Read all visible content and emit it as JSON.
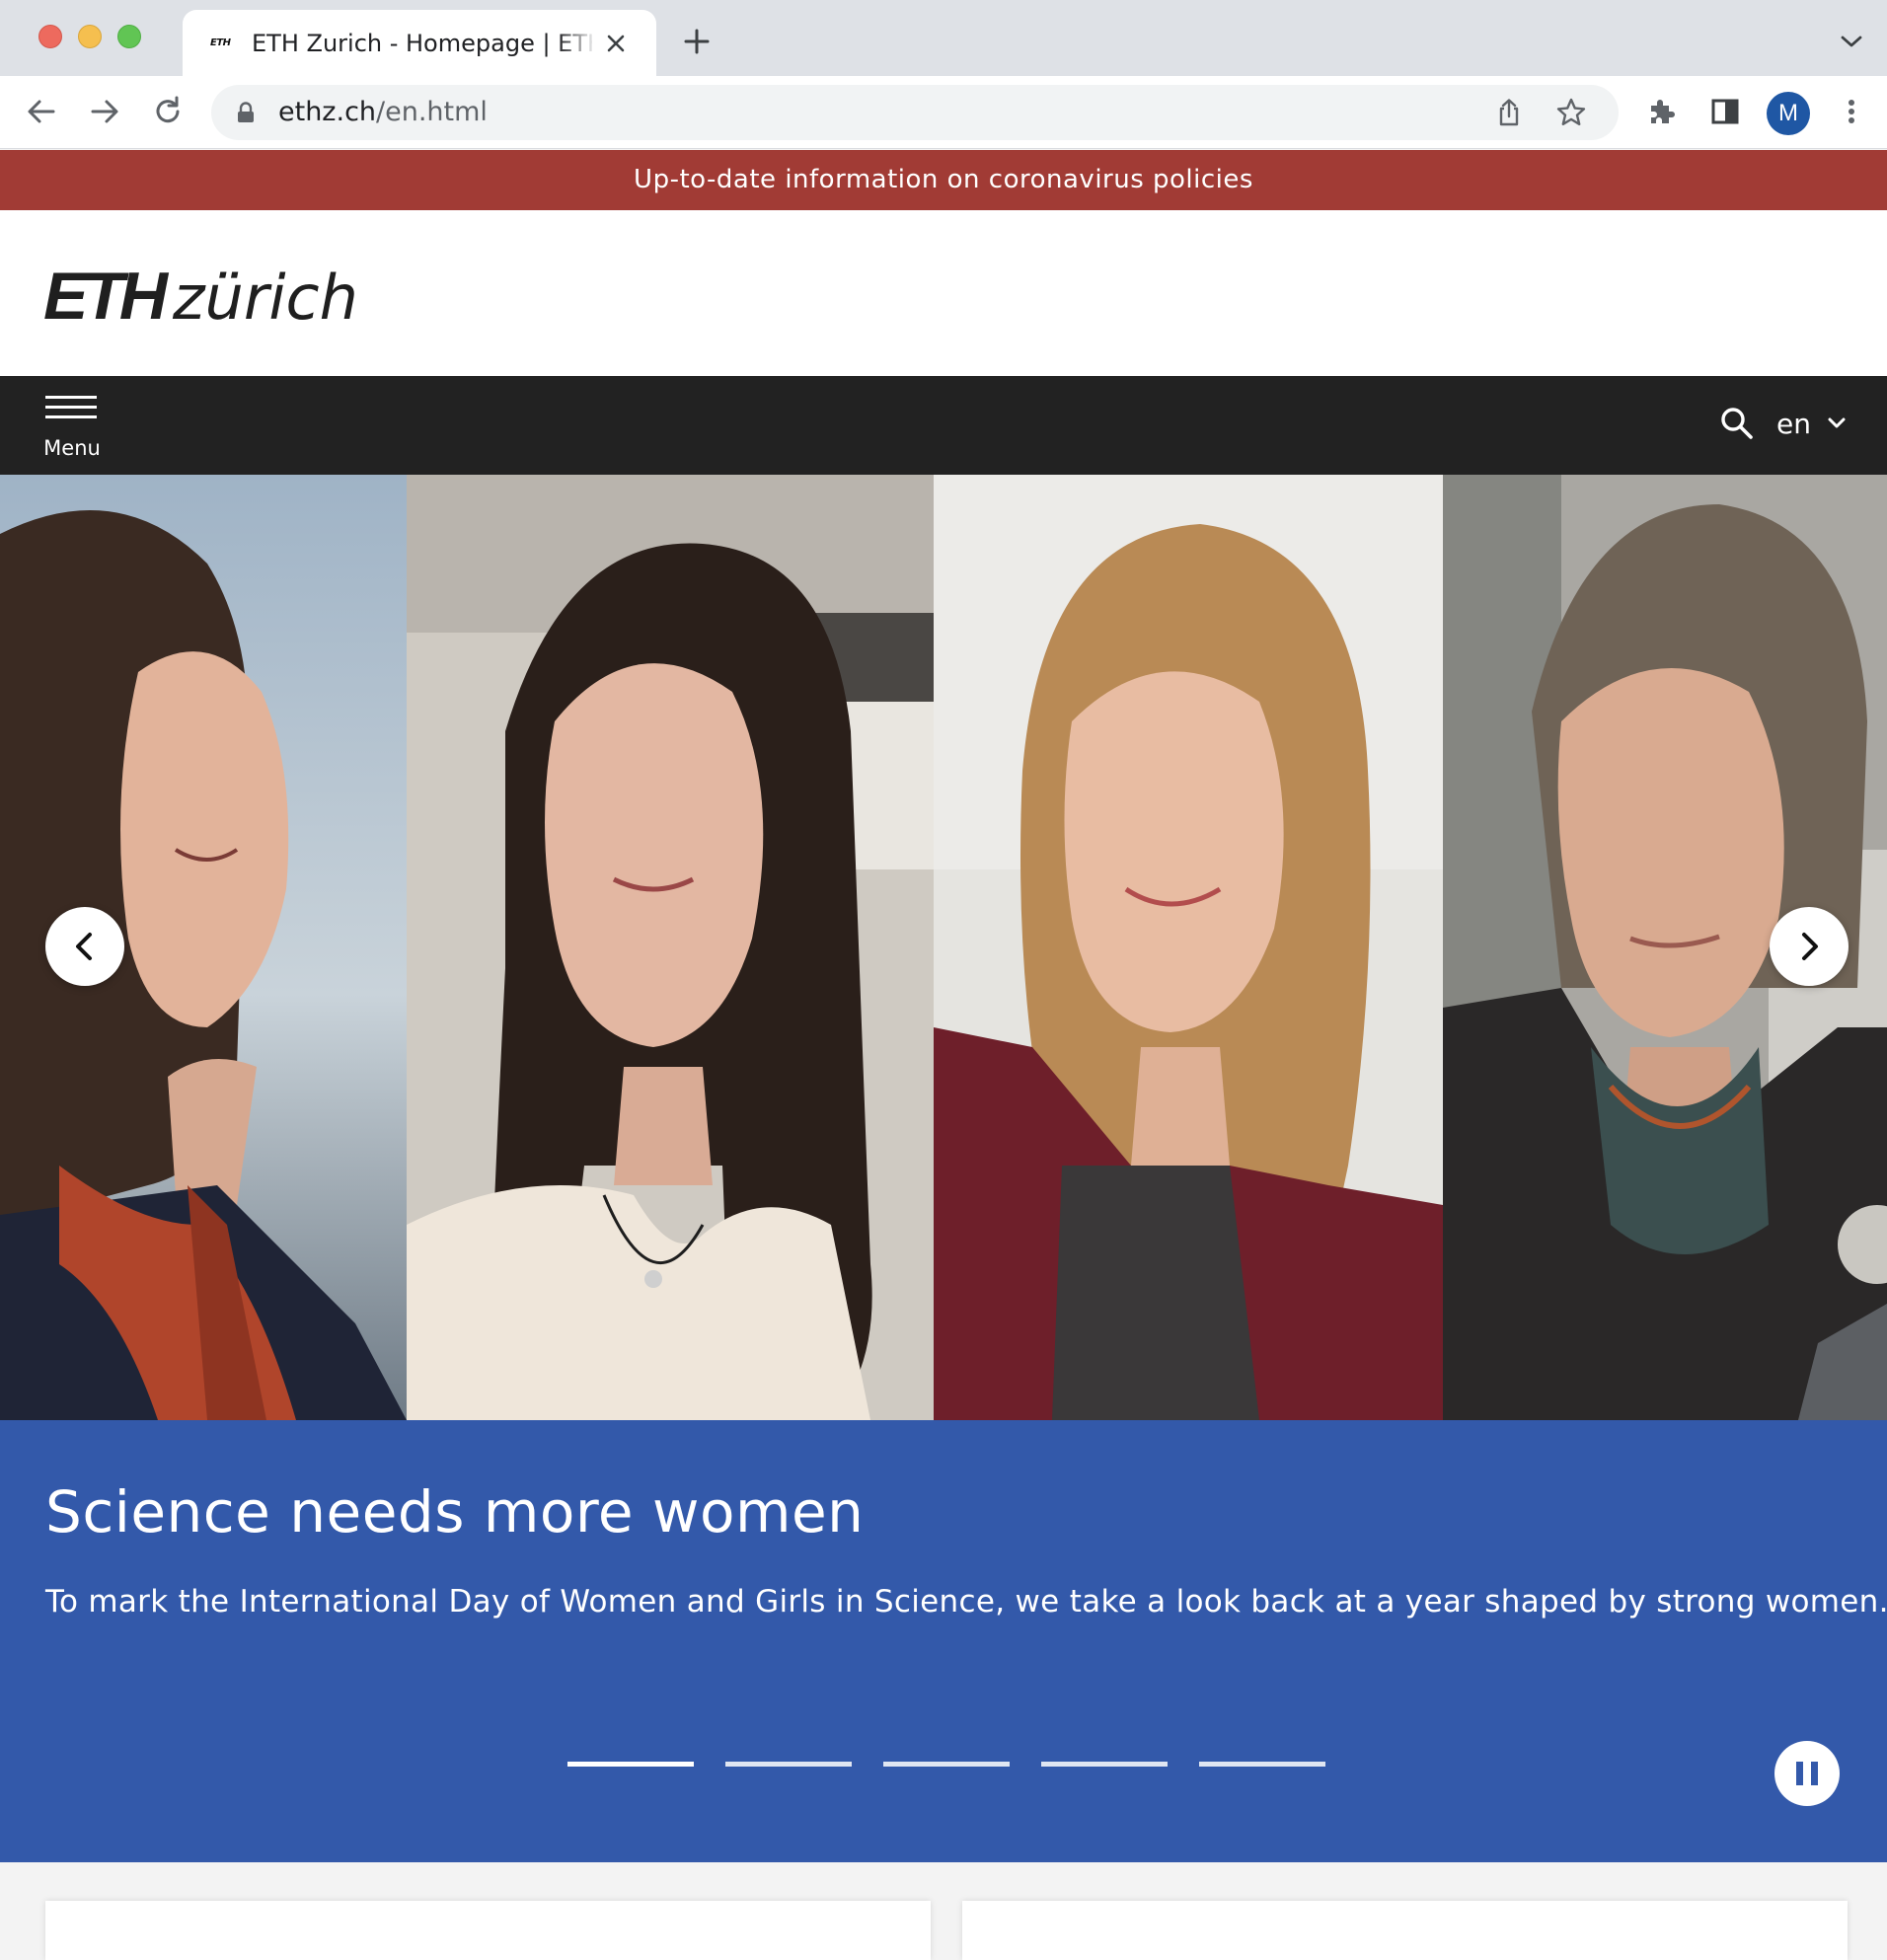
{
  "browser": {
    "tab_title": "ETH Zurich - Homepage | ETH Zurich",
    "tab_favicon_text": "ETH",
    "url_domain": "ethz.ch",
    "url_path": "/en.html",
    "profile_initial": "M"
  },
  "banner": {
    "text": "Up-to-date information on coronavirus policies",
    "color": "#a13b35"
  },
  "header": {
    "logo_eth": "ETH",
    "logo_zurich": "zürich"
  },
  "nav": {
    "menu_label": "Menu",
    "language": "en"
  },
  "hero": {
    "title": "Science needs more women",
    "subtitle": "To mark the International Day of Women and Girls in Science, we take a look back at a year shaped by strong women.",
    "slides_count": 5,
    "active_slide": 1,
    "panel_color": "#3359aa"
  },
  "icons": {
    "back": "arrow-left-icon",
    "forward": "arrow-right-icon",
    "reload": "reload-icon",
    "lock": "lock-icon",
    "share": "share-icon",
    "bookmark": "star-icon",
    "extensions": "puzzle-icon",
    "sidepanel": "side-panel-icon",
    "more": "kebab-icon",
    "search": "search-icon",
    "prev": "chevron-left-icon",
    "next": "chevron-right-icon",
    "pause": "pause-icon"
  }
}
